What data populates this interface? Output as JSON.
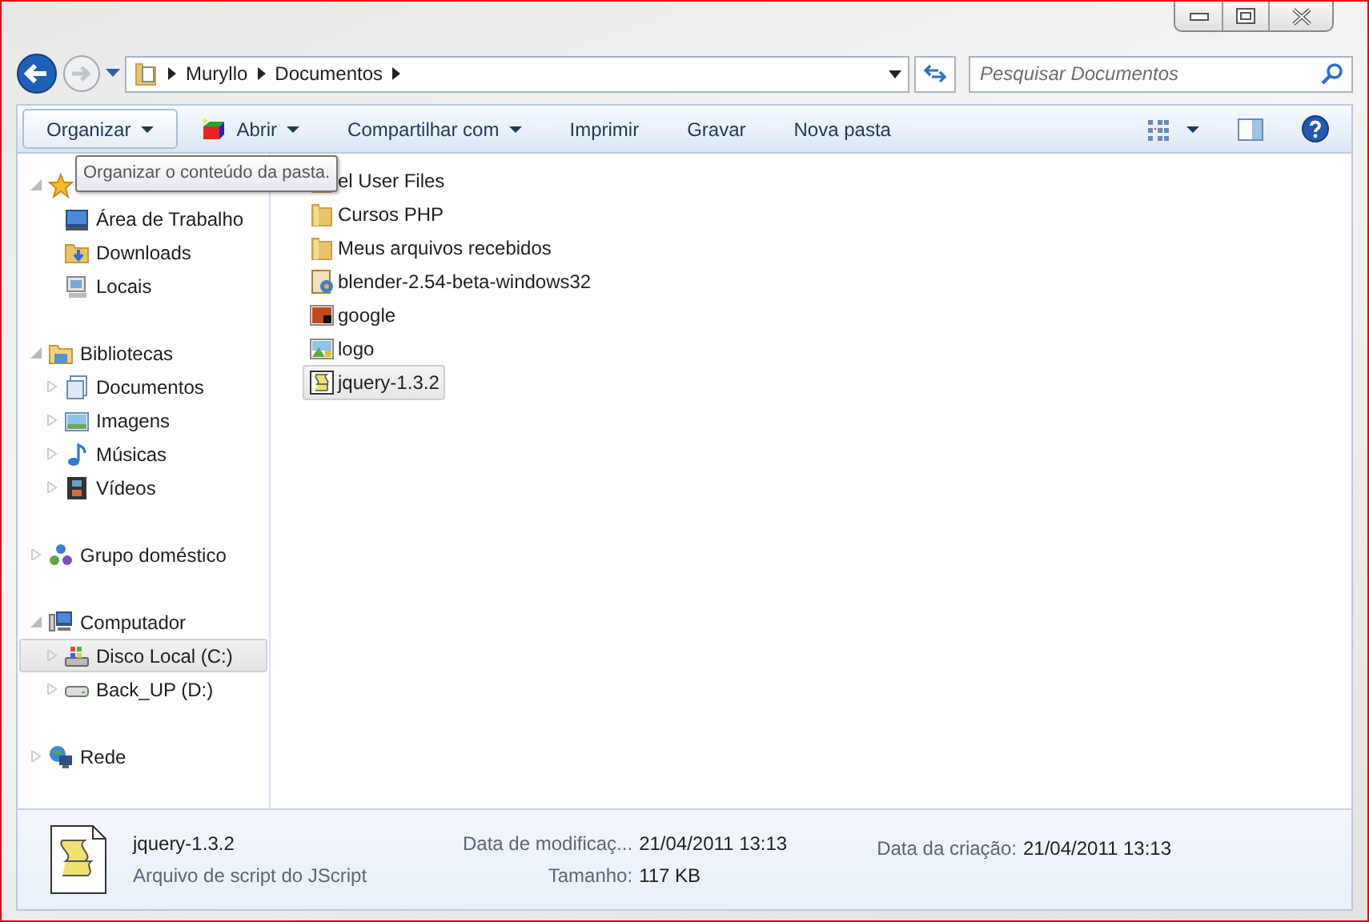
{
  "address": {
    "crumbs": [
      "Muryllo",
      "Documentos"
    ]
  },
  "search": {
    "placeholder": "Pesquisar Documentos"
  },
  "toolbar": [
    {
      "label": "Organizar",
      "menu": true,
      "kind": "plain"
    },
    {
      "label": "Abrir",
      "menu": true,
      "kind": "open"
    },
    {
      "label": "Compartilhar com",
      "menu": true,
      "kind": "plain"
    },
    {
      "label": "Imprimir",
      "menu": false,
      "kind": "plain"
    },
    {
      "label": "Gravar",
      "menu": false,
      "kind": "plain"
    },
    {
      "label": "Nova pasta",
      "menu": false,
      "kind": "plain"
    }
  ],
  "tooltip": "Organizar o conteúdo da pasta.",
  "sidebar": [
    {
      "kind": "star",
      "expanded": true,
      "children": [
        {
          "label": "Área de Trabalho",
          "kind": "desktop",
          "selected": false
        },
        {
          "label": "Downloads",
          "kind": "downloads",
          "selected": false
        },
        {
          "label": "Locais",
          "kind": "places",
          "selected": false
        }
      ]
    },
    {
      "label": "Bibliotecas",
      "kind": "library",
      "expanded": true,
      "children": [
        {
          "label": "Documentos",
          "kind": "documents",
          "selected": false
        },
        {
          "label": "Imagens",
          "kind": "images",
          "selected": false
        },
        {
          "label": "Músicas",
          "kind": "music",
          "selected": false
        },
        {
          "label": "Vídeos",
          "kind": "videos",
          "selected": false
        }
      ]
    },
    {
      "label": "Grupo doméstico",
      "kind": "homegroup",
      "expanded": false
    },
    {
      "label": "Computador",
      "kind": "computer",
      "expanded": true,
      "children": [
        {
          "label": "Disco Local (C:)",
          "kind": "sysdrive",
          "selected": true
        },
        {
          "label": "Back_UP (D:)",
          "kind": "drive",
          "selected": false
        }
      ]
    },
    {
      "label": "Rede",
      "kind": "network",
      "expanded": false
    }
  ],
  "files": [
    {
      "name": "el User Files",
      "kind": "folder",
      "selected": false
    },
    {
      "name": "Cursos PHP",
      "kind": "folder",
      "selected": false
    },
    {
      "name": "Meus arquivos recebidos",
      "kind": "folder",
      "selected": false
    },
    {
      "name": "blender-2.54-beta-windows32",
      "kind": "installer",
      "selected": false
    },
    {
      "name": "google",
      "kind": "image",
      "selected": false
    },
    {
      "name": "logo",
      "kind": "picture",
      "selected": false
    },
    {
      "name": "jquery-1.3.2",
      "kind": "script",
      "selected": true
    }
  ],
  "details": {
    "name": "jquery-1.3.2",
    "type": "Arquivo de script do JScript",
    "fields": [
      {
        "label": "Data de modificaç...",
        "value": "21/04/2011 13:13"
      },
      {
        "label": "Tamanho:",
        "value": "117 KB"
      },
      {
        "label": "Data da criação:",
        "value": "21/04/2011 13:13"
      }
    ]
  }
}
